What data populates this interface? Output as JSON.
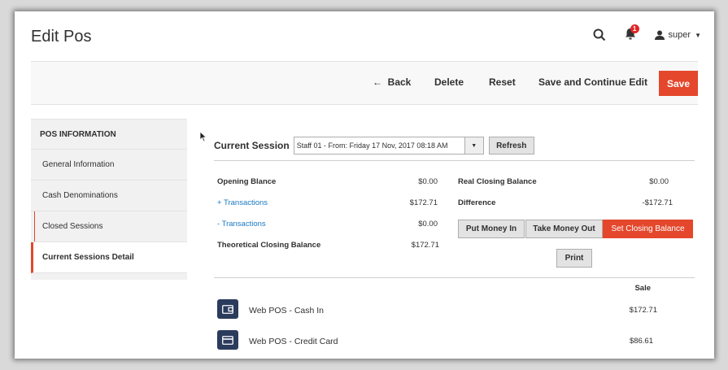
{
  "header": {
    "title": "Edit Pos",
    "notification_count": "1",
    "user": "super"
  },
  "toolbar": {
    "back": "Back",
    "delete": "Delete",
    "reset": "Reset",
    "save_continue": "Save and Continue Edit",
    "save": "Save"
  },
  "sidebar": {
    "heading": "POS INFORMATION",
    "items": [
      {
        "label": "General Information"
      },
      {
        "label": "Cash Denominations"
      },
      {
        "label": "Closed Sessions"
      },
      {
        "label": "Current Sessions Detail"
      }
    ]
  },
  "session": {
    "label": "Current Session",
    "selected": "Staff 01 - From: Friday 17 Nov, 2017 08:18 AM",
    "refresh": "Refresh"
  },
  "summary": {
    "opening_label": "Opening Blance",
    "opening_value": "$0.00",
    "plus_label": "+ Transactions",
    "plus_value": "$172.71",
    "minus_label": "- Transactions",
    "minus_value": "$0.00",
    "theoretical_label": "Theoretical Closing Balance",
    "theoretical_value": "$172.71",
    "real_label": "Real Closing Balance",
    "real_value": "$0.00",
    "difference_label": "Difference",
    "difference_value": "-$172.71"
  },
  "actions": {
    "put": "Put Money In",
    "take": "Take Money Out",
    "set": "Set Closing Balance",
    "print": "Print"
  },
  "payments": {
    "sale_header": "Sale",
    "rows": [
      {
        "name": "Web POS - Cash In",
        "sale": "$172.71",
        "icon": "wallet-icon"
      },
      {
        "name": "Web POS - Credit Card",
        "sale": "$86.61",
        "icon": "credit-card-icon"
      }
    ]
  },
  "colors": {
    "accent": "#e4472c",
    "link": "#1979c3",
    "icon_bg": "#2b3b5c"
  }
}
